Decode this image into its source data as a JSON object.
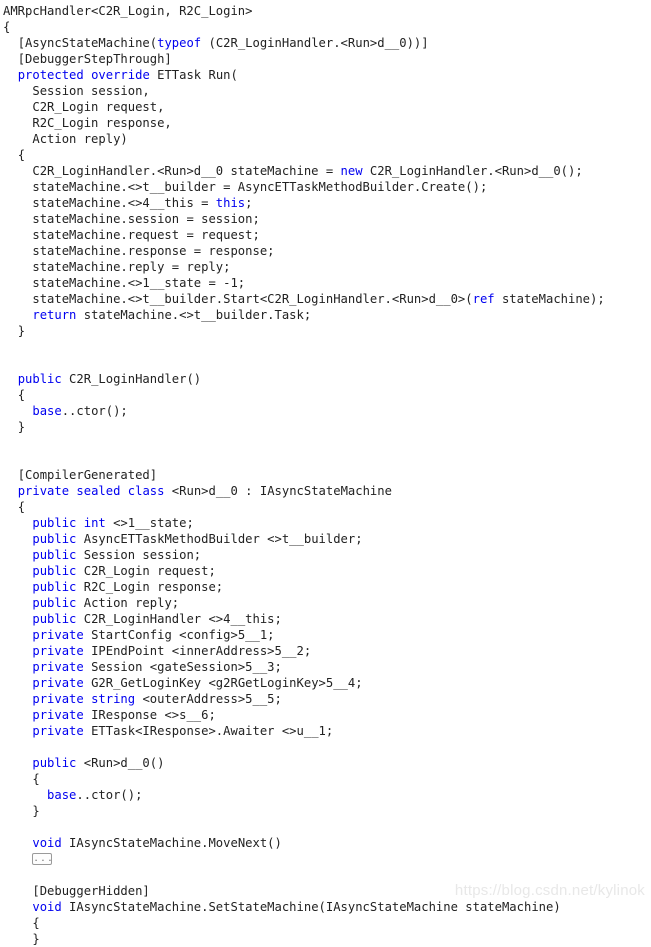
{
  "window": {
    "title": "AMRpcHandler<C2R_Login, R2C_Login>"
  },
  "watermark": {
    "text": "https://blog.csdn.net/kylinok"
  },
  "collapsed_region": {
    "dots": "...",
    "aria": "expand collapsed code block"
  },
  "code": {
    "language": "csharp",
    "keyword_color": "#0000f0",
    "text_color": "#222222",
    "background_color": "#ffffff",
    "lines": [
      {
        "id": 1,
        "indent": 0,
        "segments": [
          {
            "t": "AMRpcHandler<C2R_Login, R2C_Login>",
            "k": false
          }
        ]
      },
      {
        "id": 2,
        "indent": 0,
        "segments": [
          {
            "t": "{",
            "k": false
          }
        ]
      },
      {
        "id": 3,
        "indent": 1,
        "segments": [
          {
            "t": "[AsyncStateMachine(",
            "k": false
          },
          {
            "t": "typeof",
            "k": true
          },
          {
            "t": " (C2R_LoginHandler.<Run>d__0))]",
            "k": false
          }
        ]
      },
      {
        "id": 4,
        "indent": 1,
        "segments": [
          {
            "t": "[DebuggerStepThrough]",
            "k": false
          }
        ]
      },
      {
        "id": 5,
        "indent": 1,
        "segments": [
          {
            "t": "protected",
            "k": true
          },
          {
            "t": " ",
            "k": false
          },
          {
            "t": "override",
            "k": true
          },
          {
            "t": " ETTask Run(",
            "k": false
          }
        ]
      },
      {
        "id": 6,
        "indent": 2,
        "segments": [
          {
            "t": "Session session,",
            "k": false
          }
        ]
      },
      {
        "id": 7,
        "indent": 2,
        "segments": [
          {
            "t": "C2R_Login request,",
            "k": false
          }
        ]
      },
      {
        "id": 8,
        "indent": 2,
        "segments": [
          {
            "t": "R2C_Login response,",
            "k": false
          }
        ]
      },
      {
        "id": 9,
        "indent": 2,
        "segments": [
          {
            "t": "Action reply)",
            "k": false
          }
        ]
      },
      {
        "id": 10,
        "indent": 1,
        "segments": [
          {
            "t": "{",
            "k": false
          }
        ]
      },
      {
        "id": 11,
        "indent": 2,
        "segments": [
          {
            "t": "C2R_LoginHandler.<Run>d__0 stateMachine = ",
            "k": false
          },
          {
            "t": "new",
            "k": true
          },
          {
            "t": " C2R_LoginHandler.<Run>d__0();",
            "k": false
          }
        ]
      },
      {
        "id": 12,
        "indent": 2,
        "segments": [
          {
            "t": "stateMachine.<>t__builder = AsyncETTaskMethodBuilder.Create();",
            "k": false
          }
        ]
      },
      {
        "id": 13,
        "indent": 2,
        "segments": [
          {
            "t": "stateMachine.<>4__this = ",
            "k": false
          },
          {
            "t": "this",
            "k": true
          },
          {
            "t": ";",
            "k": false
          }
        ]
      },
      {
        "id": 14,
        "indent": 2,
        "segments": [
          {
            "t": "stateMachine.session = session;",
            "k": false
          }
        ]
      },
      {
        "id": 15,
        "indent": 2,
        "segments": [
          {
            "t": "stateMachine.request = request;",
            "k": false
          }
        ]
      },
      {
        "id": 16,
        "indent": 2,
        "segments": [
          {
            "t": "stateMachine.response = response;",
            "k": false
          }
        ]
      },
      {
        "id": 17,
        "indent": 2,
        "segments": [
          {
            "t": "stateMachine.reply = reply;",
            "k": false
          }
        ]
      },
      {
        "id": 18,
        "indent": 2,
        "segments": [
          {
            "t": "stateMachine.<>1__state = -1;",
            "k": false
          }
        ]
      },
      {
        "id": 19,
        "indent": 2,
        "segments": [
          {
            "t": "stateMachine.<>t__builder.Start<C2R_LoginHandler.<Run>d__0>(",
            "k": false
          },
          {
            "t": "ref",
            "k": true
          },
          {
            "t": " stateMachine);",
            "k": false
          }
        ]
      },
      {
        "id": 20,
        "indent": 2,
        "segments": [
          {
            "t": "return",
            "k": true
          },
          {
            "t": " stateMachine.<>t__builder.Task;",
            "k": false
          }
        ]
      },
      {
        "id": 21,
        "indent": 1,
        "segments": [
          {
            "t": "}",
            "k": false
          }
        ]
      },
      {
        "id": 22,
        "indent": 0,
        "segments": []
      },
      {
        "id": 23,
        "indent": 0,
        "segments": []
      },
      {
        "id": 24,
        "indent": 1,
        "segments": [
          {
            "t": "public",
            "k": true
          },
          {
            "t": " C2R_LoginHandler()",
            "k": false
          }
        ]
      },
      {
        "id": 25,
        "indent": 1,
        "segments": [
          {
            "t": "{",
            "k": false
          }
        ]
      },
      {
        "id": 26,
        "indent": 2,
        "segments": [
          {
            "t": "base",
            "k": true
          },
          {
            "t": "..ctor();",
            "k": false
          }
        ]
      },
      {
        "id": 27,
        "indent": 1,
        "segments": [
          {
            "t": "}",
            "k": false
          }
        ]
      },
      {
        "id": 28,
        "indent": 0,
        "segments": []
      },
      {
        "id": 29,
        "indent": 0,
        "segments": []
      },
      {
        "id": 30,
        "indent": 1,
        "segments": [
          {
            "t": "[CompilerGenerated]",
            "k": false
          }
        ]
      },
      {
        "id": 31,
        "indent": 1,
        "segments": [
          {
            "t": "private",
            "k": true
          },
          {
            "t": " ",
            "k": false
          },
          {
            "t": "sealed",
            "k": true
          },
          {
            "t": " ",
            "k": false
          },
          {
            "t": "class",
            "k": true
          },
          {
            "t": " <Run>d__0 : IAsyncStateMachine",
            "k": false
          }
        ]
      },
      {
        "id": 32,
        "indent": 1,
        "segments": [
          {
            "t": "{",
            "k": false
          }
        ]
      },
      {
        "id": 33,
        "indent": 2,
        "segments": [
          {
            "t": "public",
            "k": true
          },
          {
            "t": " ",
            "k": false
          },
          {
            "t": "int",
            "k": true
          },
          {
            "t": " <>1__state;",
            "k": false
          }
        ]
      },
      {
        "id": 34,
        "indent": 2,
        "segments": [
          {
            "t": "public",
            "k": true
          },
          {
            "t": " AsyncETTaskMethodBuilder <>t__builder;",
            "k": false
          }
        ]
      },
      {
        "id": 35,
        "indent": 2,
        "segments": [
          {
            "t": "public",
            "k": true
          },
          {
            "t": " Session session;",
            "k": false
          }
        ]
      },
      {
        "id": 36,
        "indent": 2,
        "segments": [
          {
            "t": "public",
            "k": true
          },
          {
            "t": " C2R_Login request;",
            "k": false
          }
        ]
      },
      {
        "id": 37,
        "indent": 2,
        "segments": [
          {
            "t": "public",
            "k": true
          },
          {
            "t": " R2C_Login response;",
            "k": false
          }
        ]
      },
      {
        "id": 38,
        "indent": 2,
        "segments": [
          {
            "t": "public",
            "k": true
          },
          {
            "t": " Action reply;",
            "k": false
          }
        ]
      },
      {
        "id": 39,
        "indent": 2,
        "segments": [
          {
            "t": "public",
            "k": true
          },
          {
            "t": " C2R_LoginHandler <>4__this;",
            "k": false
          }
        ]
      },
      {
        "id": 40,
        "indent": 2,
        "segments": [
          {
            "t": "private",
            "k": true
          },
          {
            "t": " StartConfig <config>5__1;",
            "k": false
          }
        ]
      },
      {
        "id": 41,
        "indent": 2,
        "segments": [
          {
            "t": "private",
            "k": true
          },
          {
            "t": " IPEndPoint <innerAddress>5__2;",
            "k": false
          }
        ]
      },
      {
        "id": 42,
        "indent": 2,
        "segments": [
          {
            "t": "private",
            "k": true
          },
          {
            "t": " Session <gateSession>5__3;",
            "k": false
          }
        ]
      },
      {
        "id": 43,
        "indent": 2,
        "segments": [
          {
            "t": "private",
            "k": true
          },
          {
            "t": " G2R_GetLoginKey <g2RGetLoginKey>5__4;",
            "k": false
          }
        ]
      },
      {
        "id": 44,
        "indent": 2,
        "segments": [
          {
            "t": "private",
            "k": true
          },
          {
            "t": " ",
            "k": false
          },
          {
            "t": "string",
            "k": true
          },
          {
            "t": " <outerAddress>5__5;",
            "k": false
          }
        ]
      },
      {
        "id": 45,
        "indent": 2,
        "segments": [
          {
            "t": "private",
            "k": true
          },
          {
            "t": " IResponse <>s__6;",
            "k": false
          }
        ]
      },
      {
        "id": 46,
        "indent": 2,
        "segments": [
          {
            "t": "private",
            "k": true
          },
          {
            "t": " ETTask<IResponse>.Awaiter <>u__1;",
            "k": false
          }
        ]
      },
      {
        "id": 47,
        "indent": 0,
        "segments": []
      },
      {
        "id": 48,
        "indent": 2,
        "segments": [
          {
            "t": "public",
            "k": true
          },
          {
            "t": " <Run>d__0()",
            "k": false
          }
        ]
      },
      {
        "id": 49,
        "indent": 2,
        "segments": [
          {
            "t": "{",
            "k": false
          }
        ]
      },
      {
        "id": 50,
        "indent": 3,
        "segments": [
          {
            "t": "base",
            "k": true
          },
          {
            "t": "..ctor();",
            "k": false
          }
        ]
      },
      {
        "id": 51,
        "indent": 2,
        "segments": [
          {
            "t": "}",
            "k": false
          }
        ]
      },
      {
        "id": 52,
        "indent": 0,
        "segments": []
      },
      {
        "id": 53,
        "indent": 2,
        "segments": [
          {
            "t": "void",
            "k": true
          },
          {
            "t": " IAsyncStateMachine.MoveNext()",
            "k": false
          }
        ]
      },
      {
        "id": 54,
        "indent": 2,
        "segments": [],
        "collapsed": true
      },
      {
        "id": 55,
        "indent": 0,
        "segments": []
      },
      {
        "id": 56,
        "indent": 2,
        "segments": [
          {
            "t": "[DebuggerHidden]",
            "k": false
          }
        ]
      },
      {
        "id": 57,
        "indent": 2,
        "segments": [
          {
            "t": "void",
            "k": true
          },
          {
            "t": " IAsyncStateMachine.SetStateMachine(IAsyncStateMachine stateMachine)",
            "k": false
          }
        ]
      },
      {
        "id": 58,
        "indent": 2,
        "segments": [
          {
            "t": "{",
            "k": false
          }
        ]
      },
      {
        "id": 59,
        "indent": 2,
        "segments": [
          {
            "t": "}",
            "k": false
          }
        ]
      }
    ]
  }
}
